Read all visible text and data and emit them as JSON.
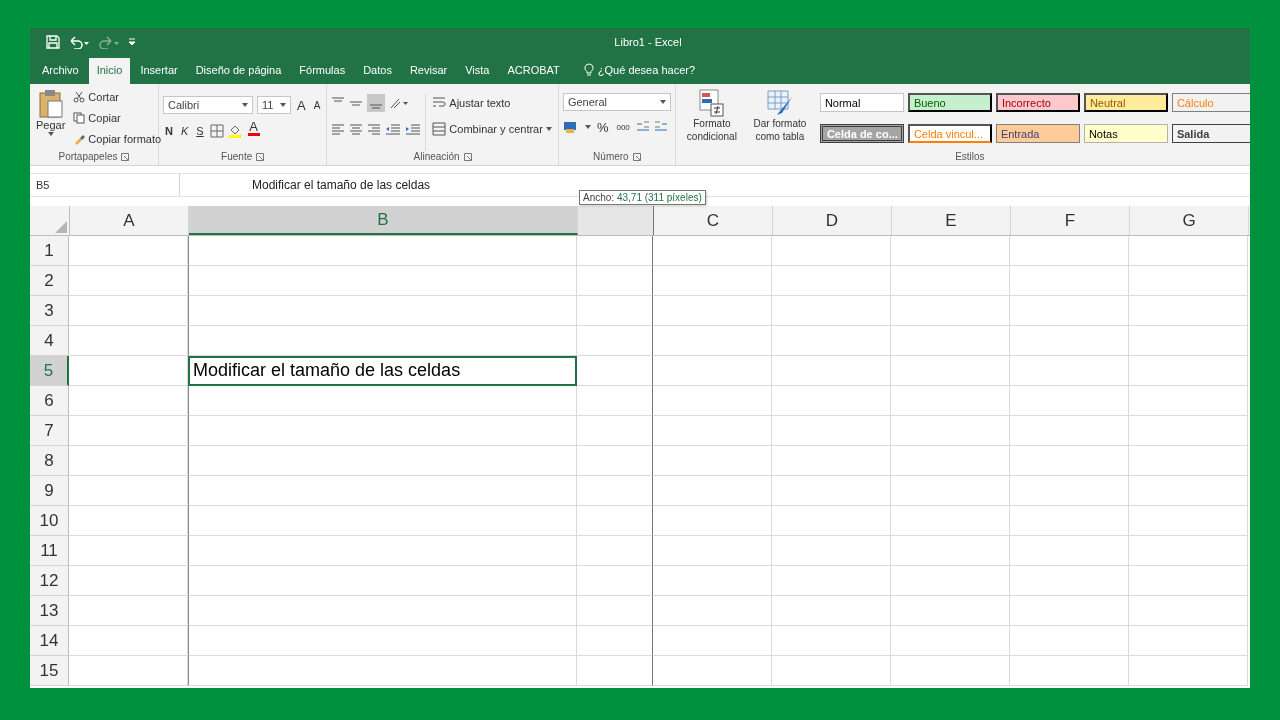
{
  "window": {
    "title": "Libro1  -  Excel"
  },
  "tabs": [
    {
      "label": "Archivo",
      "selected": false
    },
    {
      "label": "Inicio",
      "selected": true
    },
    {
      "label": "Insertar",
      "selected": false
    },
    {
      "label": "Diseño de página",
      "selected": false
    },
    {
      "label": "Fórmulas",
      "selected": false
    },
    {
      "label": "Datos",
      "selected": false
    },
    {
      "label": "Revisar",
      "selected": false
    },
    {
      "label": "Vista",
      "selected": false
    },
    {
      "label": "ACROBAT",
      "selected": false
    }
  ],
  "tell_me": {
    "placeholder": "¿Qué desea hacer?"
  },
  "clipboard": {
    "paste": "Pegar",
    "cut": "Cortar",
    "copy": "Copiar",
    "format_painter": "Copiar formato",
    "label": "Portapapeles"
  },
  "font": {
    "name": "Calibri",
    "size": "11",
    "grow": "A",
    "shrink": "A",
    "bold": "N",
    "italic": "K",
    "underline": "S",
    "font_color_letter": "A",
    "label": "Fuente"
  },
  "alignment": {
    "wrap": "Ajustar texto",
    "merge": "Combinar y centrar",
    "label": "Alineación"
  },
  "number": {
    "format": "General",
    "percent": "%",
    "thousands": "000",
    "label": "Número"
  },
  "style_commands": {
    "conditional": "Formato condicional",
    "as_table": "Dar formato como tabla"
  },
  "styles": {
    "label": "Estilos",
    "items": [
      {
        "label": "Normal",
        "kind": "normal"
      },
      {
        "label": "Bueno",
        "kind": "good"
      },
      {
        "label": "Incorrecto",
        "kind": "bad"
      },
      {
        "label": "Neutral",
        "kind": "neutral"
      },
      {
        "label": "Cálculo",
        "kind": "calculation"
      },
      {
        "label": "Celda de co...",
        "kind": "check"
      },
      {
        "label": "Celda vincul...",
        "kind": "linked"
      },
      {
        "label": "Entrada",
        "kind": "input"
      },
      {
        "label": "Notas",
        "kind": "note"
      },
      {
        "label": "Salida",
        "kind": "output"
      }
    ]
  },
  "formula_bar": {
    "name_box": "B5",
    "value": "Modificar el tamaño de las celdas"
  },
  "tooltip": {
    "label": "Ancho:",
    "value": "43,71 (311 píxeles)"
  },
  "columns": [
    {
      "label": "A",
      "selected": false
    },
    {
      "label": "B",
      "selected": true
    },
    {
      "label": "C",
      "selected": false
    },
    {
      "label": "D",
      "selected": false
    },
    {
      "label": "E",
      "selected": false
    },
    {
      "label": "F",
      "selected": false
    },
    {
      "label": "G",
      "selected": false
    }
  ],
  "rows": [
    {
      "label": "1",
      "selected": false
    },
    {
      "label": "2",
      "selected": false
    },
    {
      "label": "3",
      "selected": false
    },
    {
      "label": "4",
      "selected": false
    },
    {
      "label": "5",
      "selected": true,
      "cell_b": {
        "text": "Modificar el tamaño de las celdas",
        "selected": true
      }
    },
    {
      "label": "6",
      "selected": false
    },
    {
      "label": "7",
      "selected": false
    },
    {
      "label": "8",
      "selected": false
    },
    {
      "label": "9",
      "selected": false
    },
    {
      "label": "10",
      "selected": false
    },
    {
      "label": "11",
      "selected": false
    },
    {
      "label": "12",
      "selected": false
    },
    {
      "label": "13",
      "selected": false
    },
    {
      "label": "14",
      "selected": false
    },
    {
      "label": "15",
      "selected": false
    }
  ]
}
